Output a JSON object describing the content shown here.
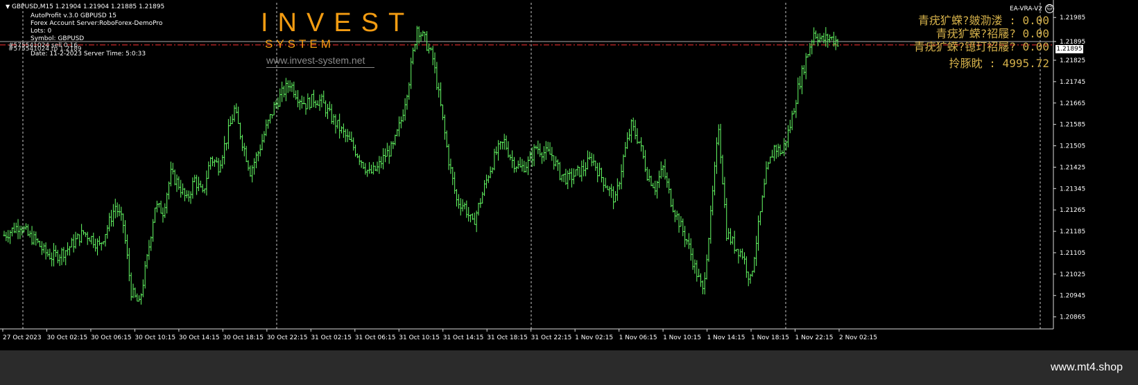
{
  "header": {
    "title": "GBPUSD,M15  1.21904 1.21904 1.21885 1.21895",
    "ea_label": "EA-VRA-V2"
  },
  "info_panel": {
    "line1": "AutoProfit v.3.0  GBPUSD  15",
    "line2": "Forex Account Server:RoboForex-DemoPro",
    "line3": "Lots:  0",
    "line4": "Symbol: GBPUSD",
    "line5": "Date: 11-2-2023 Server Time: 5:0:33",
    "overlay1": "#575541024 sell 0.16",
    "overlay2": "#575541024 tp 1.2189"
  },
  "logo": {
    "big": "INVEST",
    "small": "SYSTEM",
    "url": "www.invest-system.net"
  },
  "stats_panel": {
    "row1": "青疣犷蝾?皴泐溇  : 0.00",
    "row2": "青疣犷蝾?祒屦? 0.00",
    "row3": "青疣犷蝾?镱玎祒屦? 0.00",
    "row4": "拎豚眈 : 4995.72"
  },
  "current_price": "1.21895",
  "watermark": "www.mt4.shop",
  "colors": {
    "background": "#000000",
    "candle": "#66ff66",
    "text": "#ffffff",
    "accent": "#f39c12",
    "panel_text": "#d4b04a",
    "trade_line": "#ff3333",
    "grid": "#c8c8c8"
  },
  "chart_data": {
    "type": "candlestick",
    "symbol": "GBPUSD",
    "timeframe": "M15",
    "ohlc_last": {
      "open": 1.21904,
      "high": 1.21904,
      "low": 1.21885,
      "close": 1.21895
    },
    "trade_level": 1.2189,
    "ylim": [
      1.2082,
      1.2204
    ],
    "y_ticks": [
      "1.21985",
      "1.21895",
      "1.21825",
      "1.21745",
      "1.21665",
      "1.21585",
      "1.21505",
      "1.21425",
      "1.21345",
      "1.21265",
      "1.21185",
      "1.21105",
      "1.21025",
      "1.20945",
      "1.20865"
    ],
    "x_ticks": [
      "27 Oct 2023",
      "30 Oct 02:15",
      "30 Oct 06:15",
      "30 Oct 10:15",
      "30 Oct 14:15",
      "30 Oct 18:15",
      "30 Oct 22:15",
      "31 Oct 02:15",
      "31 Oct 06:15",
      "31 Oct 10:15",
      "31 Oct 14:15",
      "31 Oct 18:15",
      "31 Oct 22:15",
      "1 Nov 02:15",
      "1 Nov 06:15",
      "1 Nov 10:15",
      "1 Nov 14:15",
      "1 Nov 18:15",
      "1 Nov 22:15",
      "2 Nov 02:15"
    ],
    "close_series": [
      1.2117,
      1.2119,
      1.2121,
      1.2117,
      1.2115,
      1.2111,
      1.2109,
      1.211,
      1.2112,
      1.2115,
      1.2118,
      1.2116,
      1.2113,
      1.212,
      1.2128,
      1.2121,
      1.2096,
      1.2091,
      1.2108,
      1.2128,
      1.2126,
      1.214,
      1.2136,
      1.213,
      1.2138,
      1.2132,
      1.2146,
      1.2143,
      1.2153,
      1.2164,
      1.2152,
      1.2141,
      1.2148,
      1.2157,
      1.2165,
      1.217,
      1.2174,
      1.2169,
      1.2166,
      1.2168,
      1.2167,
      1.2162,
      1.2158,
      1.2154,
      1.215,
      1.2145,
      1.214,
      1.2142,
      1.2147,
      1.215,
      1.216,
      1.2175,
      1.2195,
      1.219,
      1.2183,
      1.2165,
      1.2145,
      1.213,
      1.2128,
      1.2121,
      1.213,
      1.214,
      1.2148,
      1.2152,
      1.2145,
      1.2142,
      1.2144,
      1.215,
      1.2148,
      1.2147,
      1.214,
      1.2138,
      1.214,
      1.2142,
      1.2146,
      1.214,
      1.2135,
      1.213,
      1.2146,
      1.2158,
      1.2152,
      1.214,
      1.2135,
      1.2142,
      1.213,
      1.2122,
      1.2115,
      1.2105,
      1.2096,
      1.2124,
      1.2158,
      1.2118,
      1.2113,
      1.211,
      1.21,
      1.212,
      1.214,
      1.215,
      1.2148,
      1.2158,
      1.2172,
      1.2183,
      1.2193,
      1.219,
      1.2191,
      1.21895
    ]
  }
}
